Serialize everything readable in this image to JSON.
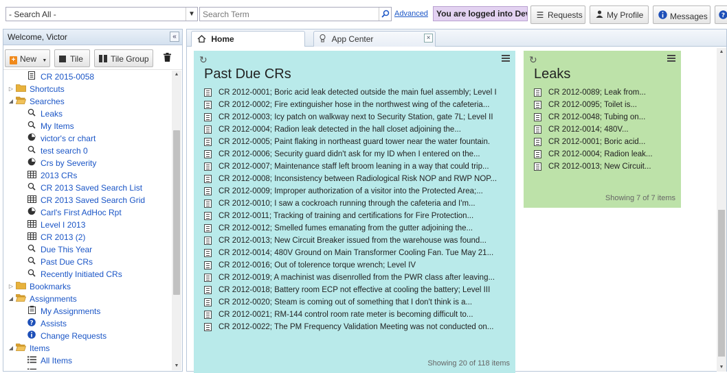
{
  "topbar": {
    "search_scope": "- Search All -",
    "search_placeholder": "Search Term",
    "advanced_link": "Advanced",
    "logged_text": "You are logged into Dev.",
    "requests_label": "Requests",
    "profile_label": "My Profile",
    "messages_label": "Messages"
  },
  "sidebar": {
    "welcome": "Welcome, Victor",
    "new_label": "New",
    "tile_label": "Tile",
    "tile_group_label": "Tile Group",
    "tree": [
      {
        "level": 2,
        "icon": "document-icon",
        "label": "CR 2015-0058"
      },
      {
        "level": 1,
        "icon": "folder-icon",
        "label": "Shortcuts",
        "expander": "collapsed"
      },
      {
        "level": 1,
        "icon": "folder-open-icon",
        "label": "Searches",
        "expander": "expanded"
      },
      {
        "level": 2,
        "icon": "search-icon",
        "label": "Leaks"
      },
      {
        "level": 2,
        "icon": "search-icon",
        "label": "My Items"
      },
      {
        "level": 2,
        "icon": "pie-chart-icon",
        "label": "victor's cr chart"
      },
      {
        "level": 2,
        "icon": "search-icon",
        "label": "test search 0"
      },
      {
        "level": 2,
        "icon": "pie-chart-icon",
        "label": "Crs by Severity"
      },
      {
        "level": 2,
        "icon": "grid-icon",
        "label": "2013 CRs"
      },
      {
        "level": 2,
        "icon": "search-icon",
        "label": "CR 2013 Saved Search List"
      },
      {
        "level": 2,
        "icon": "grid-icon",
        "label": "CR 2013 Saved Search Grid"
      },
      {
        "level": 2,
        "icon": "pie-chart-icon",
        "label": "Carl's First AdHoc Rpt"
      },
      {
        "level": 2,
        "icon": "grid-icon",
        "label": "Level I 2013"
      },
      {
        "level": 2,
        "icon": "grid-icon",
        "label": "CR 2013 (2)"
      },
      {
        "level": 2,
        "icon": "search-icon",
        "label": "Due This Year"
      },
      {
        "level": 2,
        "icon": "search-icon",
        "label": "Past Due CRs"
      },
      {
        "level": 2,
        "icon": "search-icon",
        "label": "Recently Initiated CRs"
      },
      {
        "level": 1,
        "icon": "folder-icon",
        "label": "Bookmarks",
        "expander": "collapsed"
      },
      {
        "level": 1,
        "icon": "folder-open-icon",
        "label": "Assignments",
        "expander": "expanded"
      },
      {
        "level": 2,
        "icon": "clipboard-icon",
        "label": "My Assignments"
      },
      {
        "level": 2,
        "icon": "help-circle-icon",
        "label": "Assists"
      },
      {
        "level": 2,
        "icon": "info-circle-icon",
        "label": "Change Requests"
      },
      {
        "level": 1,
        "icon": "folder-open-icon",
        "label": "Items",
        "expander": "expanded"
      },
      {
        "level": 2,
        "icon": "list-icon",
        "label": "All Items"
      },
      {
        "level": 2,
        "icon": "list-icon",
        "label": "Drawer Nod..."
      }
    ]
  },
  "tabs": [
    {
      "label": "Home",
      "icon": "home-icon"
    },
    {
      "label": "App Center",
      "icon": "lightbulb-icon"
    }
  ],
  "tiles": {
    "past_due": {
      "title": "Past Due CRs",
      "footer": "Showing 20 of 118 items",
      "color": "#b9eaea",
      "items": [
        "CR 2012-0001; Boric acid leak detected outside the main fuel assembly; Level I",
        "CR 2012-0002; Fire extinguisher hose in the northwest wing of the cafeteria...",
        "CR 2012-0003; Icy patch on walkway next to Security Station, gate 7L; Level II",
        "CR 2012-0004; Radion leak detected in the hall closet adjoining the...",
        "CR 2012-0005; Paint flaking in northeast guard tower near the water fountain.",
        "CR 2012-0006; Security guard didn't ask for my ID when I entered on the...",
        "CR 2012-0007; Maintenance staff left broom leaning in a way that could trip...",
        "CR 2012-0008; Inconsistency between Radiological Risk NOP and RWP NOP...",
        "CR 2012-0009; Improper authorization of a visitor into the Protected Area;...",
        "CR 2012-0010; I saw a cockroach running through the cafeteria and I'm...",
        "CR 2012-0011; Tracking of training and certifications for Fire Protection...",
        "CR 2012-0012; Smelled fumes emanating from the gutter adjoining the...",
        "CR 2012-0013; New Circuit Breaker issued from the warehouse was found...",
        "CR 2012-0014; 480V Ground on Main Transformer Cooling Fan. Tue May 21...",
        "CR 2012-0016; Out of tolerence torque wrench; Level IV",
        "CR 2012-0019; A machinist was disenrolled from the PWR class after leaving...",
        "CR 2012-0018; Battery room ECP not effective at cooling the battery; Level III",
        "CR 2012-0020; Steam is coming out of something that I don't think is a...",
        "CR 2012-0021; RM-144 control room rate meter is becoming difficult to...",
        "CR 2012-0022; The PM Frequency Validation Meeting was not conducted on..."
      ]
    },
    "leaks": {
      "title": "Leaks",
      "footer": "Showing 7 of 7 items",
      "color": "#bde2a9",
      "items": [
        "CR 2012-0089; Leak from...",
        "CR 2012-0095; Toilet is...",
        "CR 2012-0048; Tubing on...",
        "CR 2012-0014; 480V...",
        "CR 2012-0001; Boric acid...",
        "CR 2012-0004; Radion leak...",
        "CR 2012-0013; New Circuit..."
      ]
    }
  }
}
